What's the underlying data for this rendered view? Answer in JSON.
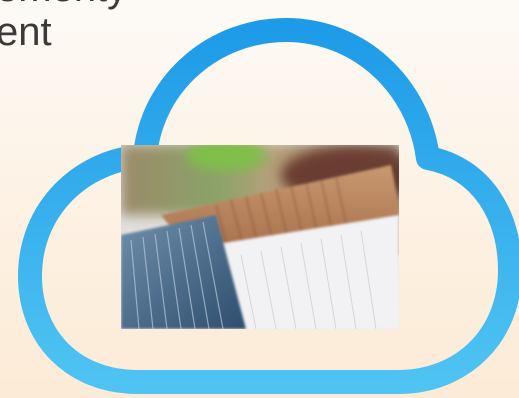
{
  "slide": {
    "title_lines": [
      "ementy",
      "ent"
    ],
    "accent_color": "#2a9ee6",
    "text_color": "#3a3a3a"
  },
  "graphic": {
    "icon": "cloud-icon",
    "photo": "file-folders-photo"
  }
}
